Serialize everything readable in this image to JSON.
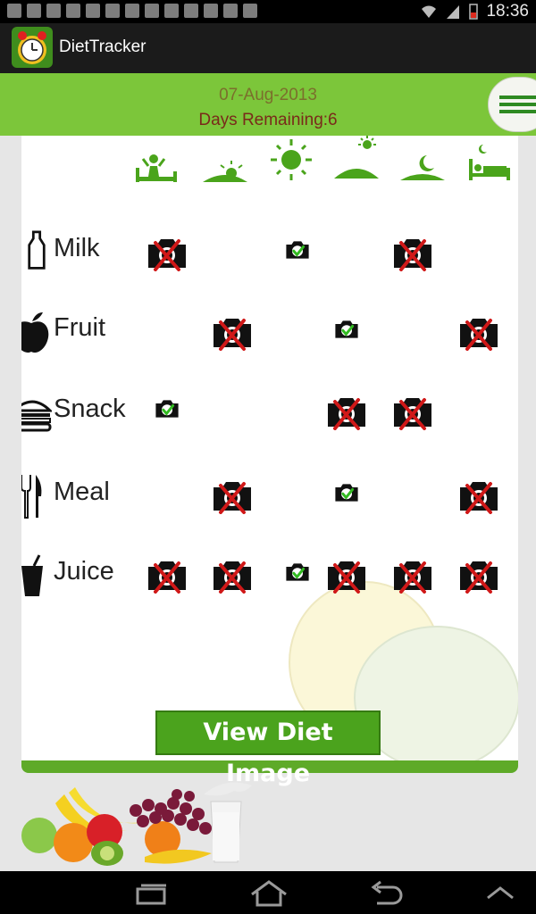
{
  "status_bar": {
    "time": "18:36",
    "battery_color": "#dc2a1e"
  },
  "app": {
    "title": "DietTracker"
  },
  "header": {
    "date": "07-Aug-2013",
    "days_remaining": "Days Remaining:6"
  },
  "time_slots": [
    "wake-up",
    "sunrise",
    "midday-sun",
    "afternoon",
    "evening-moon",
    "bedtime"
  ],
  "rows": [
    {
      "label": "Milk",
      "icon": "milk-bottle-icon",
      "cells": [
        "missed",
        "",
        "done",
        "",
        "missed",
        ""
      ]
    },
    {
      "label": "Fruit",
      "icon": "apple-icon",
      "cells": [
        "",
        "missed",
        "",
        "done",
        "",
        "missed"
      ]
    },
    {
      "label": "Snack",
      "icon": "burger-icon",
      "cells": [
        "done",
        "",
        "",
        "missed",
        "missed",
        ""
      ]
    },
    {
      "label": "Meal",
      "icon": "fork-knife-icon",
      "cells": [
        "",
        "missed",
        "",
        "done",
        "",
        "missed"
      ]
    },
    {
      "label": "Juice",
      "icon": "cup-icon",
      "cells": [
        "missed",
        "missed",
        "done",
        "missed",
        "missed",
        "missed"
      ]
    }
  ],
  "actions": {
    "view_button": "View Diet Image"
  },
  "colors": {
    "accent_green": "#7cc63a",
    "icon_green": "#4aa41b",
    "missed_red": "#d01818",
    "done_green": "#33bb22"
  }
}
